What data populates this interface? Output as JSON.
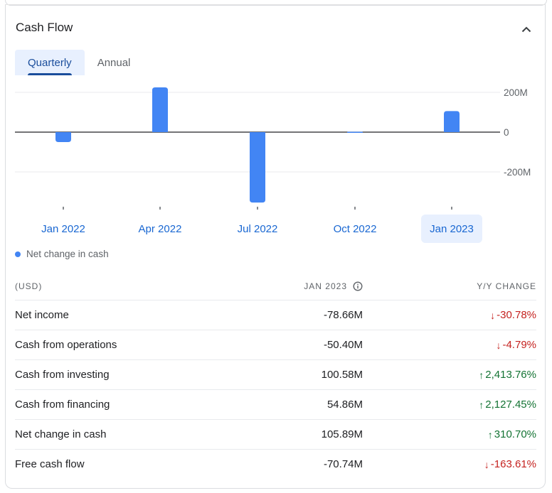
{
  "section": {
    "title": "Cash Flow",
    "collapse_icon": "chevron-up-icon"
  },
  "tabs": [
    {
      "label": "Quarterly",
      "active": true
    },
    {
      "label": "Annual",
      "active": false
    }
  ],
  "colors": {
    "bar": "#4285f4",
    "accent": "#1a4d9c",
    "link": "#1967d2",
    "negative": "#c5221f",
    "positive": "#137333"
  },
  "chart_data": {
    "type": "bar",
    "title": "",
    "categories": [
      "Jan 2022",
      "Apr 2022",
      "Jul 2022",
      "Oct 2022",
      "Jan 2023"
    ],
    "series": [
      {
        "name": "Net change in cash",
        "values": [
          -50,
          225,
          -354,
          2,
          105.89
        ]
      }
    ],
    "y_ticks": [
      {
        "value": 200,
        "label": "200M"
      },
      {
        "value": 0,
        "label": "0"
      },
      {
        "value": -200,
        "label": "-200M"
      }
    ],
    "ylim": [
      -360,
      240
    ],
    "yunit": "M",
    "selected_category": "Jan 2023",
    "grid": true,
    "legend": "bottom-left"
  },
  "legend": {
    "label": "Net change in cash"
  },
  "table": {
    "headers": {
      "label": "(USD)",
      "period": "JAN 2023",
      "change": "Y/Y CHANGE"
    },
    "rows": [
      {
        "label": "Net income",
        "value": "-78.66M",
        "change": "-30.78%",
        "direction": "down"
      },
      {
        "label": "Cash from operations",
        "value": "-50.40M",
        "change": "-4.79%",
        "direction": "down"
      },
      {
        "label": "Cash from investing",
        "value": "100.58M",
        "change": "2,413.76%",
        "direction": "up"
      },
      {
        "label": "Cash from financing",
        "value": "54.86M",
        "change": "2,127.45%",
        "direction": "up"
      },
      {
        "label": "Net change in cash",
        "value": "105.89M",
        "change": "310.70%",
        "direction": "up"
      },
      {
        "label": "Free cash flow",
        "value": "-70.74M",
        "change": "-163.61%",
        "direction": "down"
      }
    ]
  }
}
